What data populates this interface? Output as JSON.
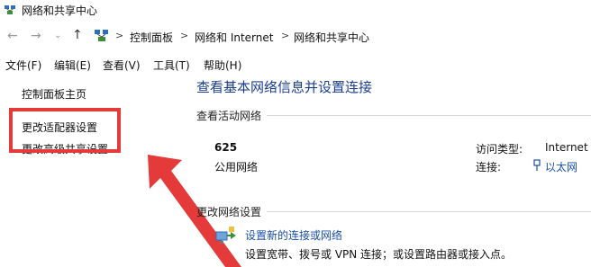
{
  "window": {
    "title": "网络和共享中心"
  },
  "address_bar": {
    "crumbs": [
      "控制面板",
      "网络和 Internet",
      "网络和共享中心"
    ],
    "separator": ">"
  },
  "menu": {
    "items": [
      "文件(F)",
      "编辑(E)",
      "查看(V)",
      "工具(T)",
      "帮助(H)"
    ]
  },
  "sidebar": {
    "items": [
      {
        "label": "控制面板主页"
      },
      {
        "label": "更改适配器设置"
      },
      {
        "label": "更改高级共享设置"
      }
    ]
  },
  "main": {
    "title": "查看基本网络信息并设置连接",
    "active_section": "查看活动网络",
    "network": {
      "name": "625",
      "type": "公用网络",
      "access_type_label": "访问类型:",
      "access_type_value": "Internet",
      "connection_label": "连接:",
      "connection_value": "以太网"
    },
    "change_section": "更改网络设置",
    "setup": {
      "link": "设置新的连接或网络",
      "description": "设置宽带、拨号或 VPN 连接；或设置路由器或接入点。"
    }
  },
  "colors": {
    "annotation_red": "#e53a3a",
    "link_blue": "#1a4fa8",
    "title_blue": "#1a3e8f"
  }
}
